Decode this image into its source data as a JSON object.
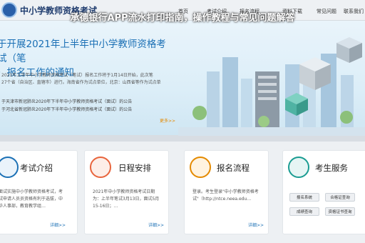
{
  "header": {
    "site_title": "中小学教师资格考试",
    "nav": [
      "首页",
      "考试介绍",
      "报名流程",
      "资料下载",
      "常见问题",
      "联系我们"
    ]
  },
  "overlay_title": "承德银行APP流水打印指南，操作教程与常见问题解答",
  "hero": {
    "title_line1": "于开展2021年上半年中小学教师资格考试（笔",
    "title_line2": "）报名工作的通知",
    "desc_line1": "2021年上半年中小学教师资格考试（笔试）报名工作将于1月14日开始，此次笔",
    "desc_line2": "27个省（自治区、直辖市）进行。海南省作为试点单位，北京：山西省等作为试点单",
    "list": [
      "于天津市新冠肺炎2020年下半年中小学教师资格考试（面试）的公告",
      "于河北省新冠肺炎2020年下半年中小学教师资格考试（面试）的公告"
    ],
    "more": "更多>>"
  },
  "cards": [
    {
      "title": "考试介绍",
      "text": "面试实施中小学教师资格考试，考试申请人员员资格有利于选拔，中华人事部，教育教学组…",
      "more": "详细>>"
    },
    {
      "title": "日程安排",
      "text": "2021年中小学教师资格考试日期为：上半年笔试3月13日，面试5月15-16日；…",
      "more": "详细>>"
    },
    {
      "title": "报名流程",
      "text": "登录。考生登录\"中小学教师资格考试\"（http://ntce.neea.edu…",
      "more": "详细>>"
    },
    {
      "title": "考生服务",
      "buttons": [
        "报名系统",
        "合格证查询",
        "成绩查询",
        "资格证书查询"
      ]
    }
  ],
  "colors": {
    "primary_blue": "#1b70b5",
    "accent_orange": "#e48a00"
  }
}
